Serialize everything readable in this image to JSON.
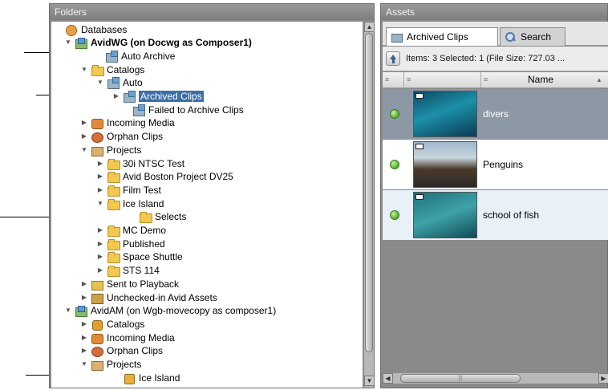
{
  "folders": {
    "title": "Folders",
    "rows": [
      {
        "label": "Databases",
        "icon": "database-icon",
        "expander": "",
        "bold": false,
        "selected": false
      },
      {
        "label": "AvidWG (on Docwg as Composer1)",
        "icon": "workgroup-icon",
        "expander": "▼",
        "bold": true,
        "selected": false
      },
      {
        "label": "Auto Archive",
        "icon": "clip-folder-icon",
        "expander": "",
        "bold": false,
        "selected": false
      },
      {
        "label": "Catalogs",
        "icon": "folder-icon",
        "expander": "▼",
        "bold": false,
        "selected": false
      },
      {
        "label": "Auto",
        "icon": "clip-folder-icon",
        "expander": "▼",
        "bold": false,
        "selected": false
      },
      {
        "label": "Archived Clips",
        "icon": "clip-folder-icon",
        "expander": "▶",
        "bold": false,
        "selected": true
      },
      {
        "label": "Failed to Archive Clips",
        "icon": "clip-folder-icon",
        "expander": "",
        "bold": false,
        "selected": false
      },
      {
        "label": "Incoming Media",
        "icon": "incoming-media-icon",
        "expander": "▶",
        "bold": false,
        "selected": false
      },
      {
        "label": "Orphan Clips",
        "icon": "orphan-clips-icon",
        "expander": "▶",
        "bold": false,
        "selected": false
      },
      {
        "label": "Projects",
        "icon": "projects-icon",
        "expander": "▼",
        "bold": false,
        "selected": false
      },
      {
        "label": "30i NTSC Test",
        "icon": "folder-icon",
        "expander": "▶",
        "bold": false,
        "selected": false
      },
      {
        "label": "Avid Boston Project DV25",
        "icon": "folder-icon",
        "expander": "▶",
        "bold": false,
        "selected": false
      },
      {
        "label": "Film Test",
        "icon": "folder-icon",
        "expander": "▶",
        "bold": false,
        "selected": false
      },
      {
        "label": "Ice Island",
        "icon": "folder-icon",
        "expander": "▼",
        "bold": false,
        "selected": false
      },
      {
        "label": "Selects",
        "icon": "folder-icon",
        "expander": "",
        "bold": false,
        "selected": false
      },
      {
        "label": "MC Demo",
        "icon": "folder-icon",
        "expander": "▶",
        "bold": false,
        "selected": false
      },
      {
        "label": "Published",
        "icon": "folder-icon",
        "expander": "▶",
        "bold": false,
        "selected": false
      },
      {
        "label": "Space Shuttle",
        "icon": "folder-icon",
        "expander": "▶",
        "bold": false,
        "selected": false
      },
      {
        "label": "STS 114",
        "icon": "folder-icon",
        "expander": "▶",
        "bold": false,
        "selected": false
      },
      {
        "label": "Sent to Playback",
        "icon": "sent-to-playback-icon",
        "expander": "▶",
        "bold": false,
        "selected": false
      },
      {
        "label": "Unchecked-in Avid Assets",
        "icon": "unchecked-assets-icon",
        "expander": "▶",
        "bold": false,
        "selected": false
      },
      {
        "label": "AvidAM (on Wgb-movecopy as composer1)",
        "icon": "workgroup-icon",
        "expander": "▼",
        "bold": false,
        "selected": false
      },
      {
        "label": "Catalogs",
        "icon": "catalogs-icon",
        "expander": "▶",
        "bold": false,
        "selected": false
      },
      {
        "label": "Incoming Media",
        "icon": "incoming-media-icon",
        "expander": "▶",
        "bold": false,
        "selected": false
      },
      {
        "label": "Orphan Clips",
        "icon": "orphan-clips-icon",
        "expander": "▶",
        "bold": false,
        "selected": false
      },
      {
        "label": "Projects",
        "icon": "projects-icon",
        "expander": "▼",
        "bold": false,
        "selected": false
      },
      {
        "label": "Ice Island",
        "icon": "project-icon",
        "expander": "",
        "bold": false,
        "selected": false
      }
    ]
  },
  "assets": {
    "title": "Assets",
    "tabs": [
      {
        "label": "Archived Clips",
        "icon": "clip-icon",
        "active": true
      },
      {
        "label": "Search",
        "icon": "search-icon",
        "active": false
      }
    ],
    "info": "Items: 3 Selected: 1 (File Size: 727.03 ...",
    "columns": {
      "col1": "≡",
      "col2": "≡",
      "col3_grip": "≡",
      "name": "Name",
      "sort": "▲"
    },
    "items": [
      {
        "name": "divers",
        "status": "online",
        "selected": true
      },
      {
        "name": "Penguins",
        "status": "online",
        "selected": false
      },
      {
        "name": "school of fish",
        "status": "online",
        "selected": false
      }
    ],
    "hscroll_grip": "|||"
  },
  "colors": {
    "selection": "#3c6ea8",
    "asset_selected_row": "#8d98a6",
    "asset_alt_row": "#e8f0f8",
    "panel_title": "#8a8a8a"
  }
}
